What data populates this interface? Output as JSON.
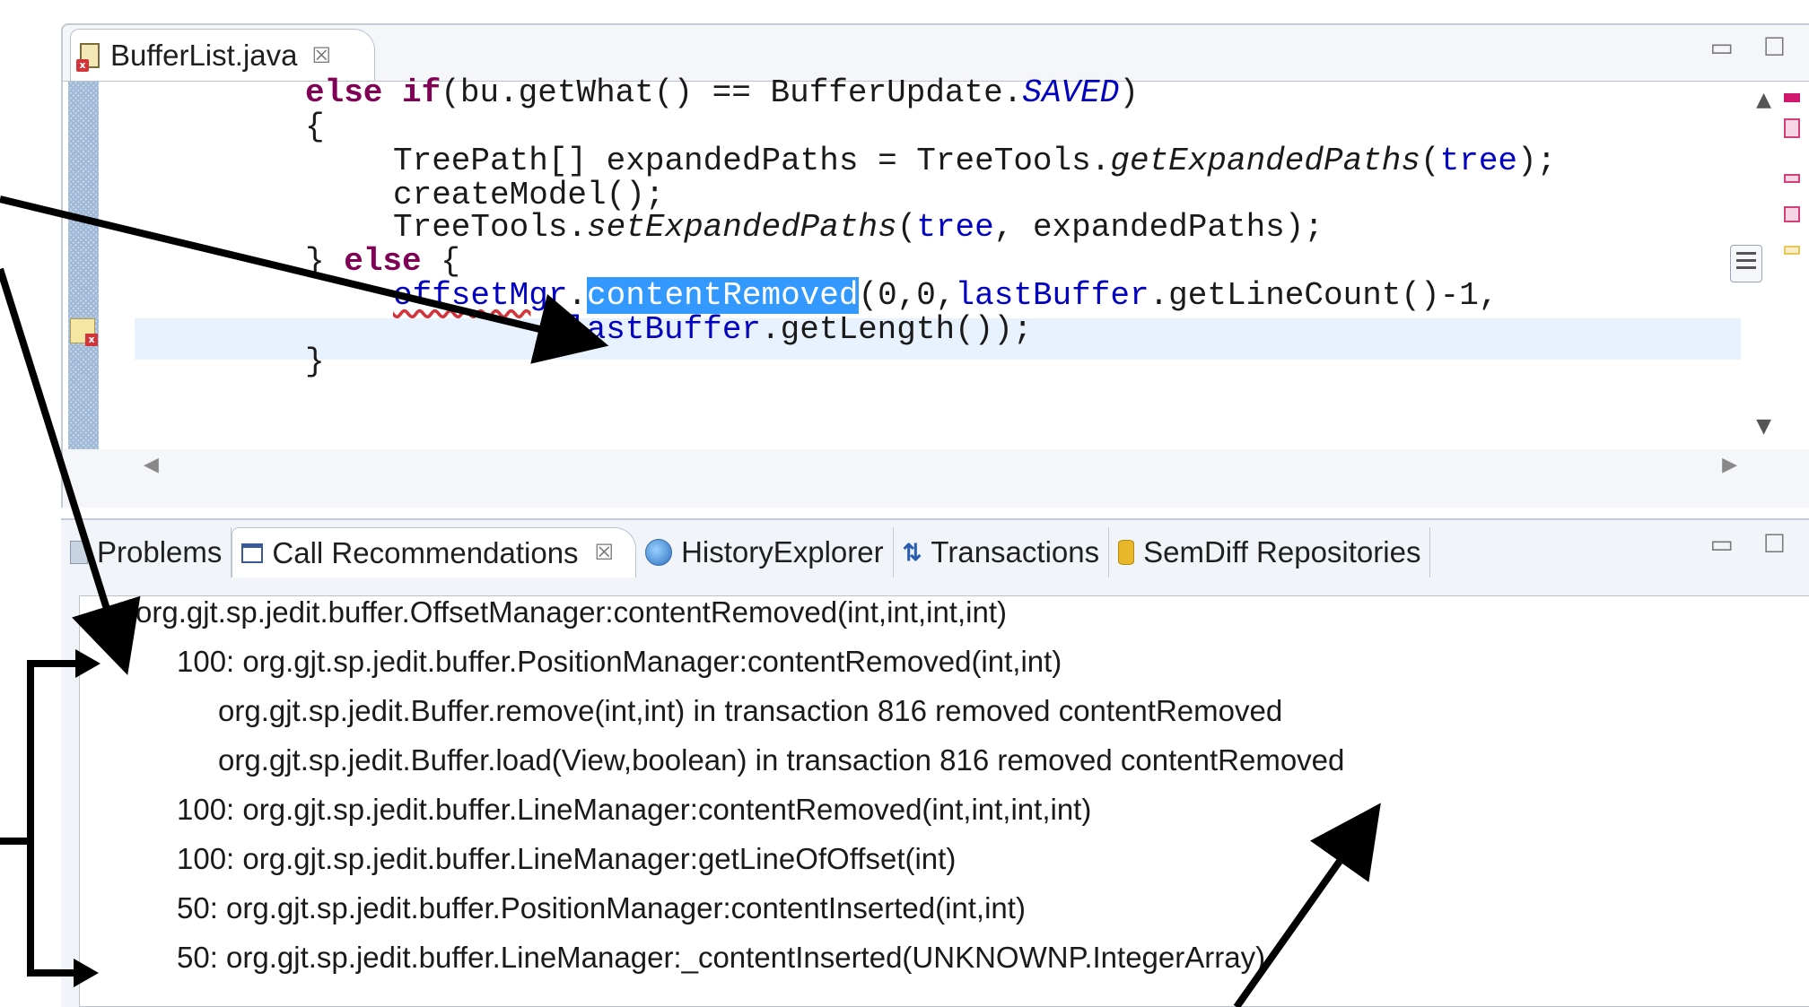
{
  "editor": {
    "tab_label": "BufferList.java",
    "tab_close": "☒",
    "pane_controls": "▭ ☐",
    "code_lines": {
      "l1": {
        "kw1": "else if",
        "rest1": "(bu.getWhat() == BufferUpdate.",
        "const": "SAVED",
        "rest2": ")"
      },
      "l2": "{",
      "l3": {
        "a": "TreePath[] expandedPaths = TreeTools.",
        "it": "getExpandedPaths",
        "b": "(",
        "fld": "tree",
        "c": ");"
      },
      "l4": "createModel();",
      "l5": {
        "a": "TreeTools.",
        "it": "setExpandedPaths",
        "b": "(",
        "fld": "tree",
        "c": ", expandedPaths);"
      },
      "l6": {
        "a": "} ",
        "kw": "else",
        "b": " {"
      },
      "l7": {
        "err": "offsetMgr",
        "dot": ".",
        "sel": "contentRemoved",
        "a": "(0,0,",
        "fld": "lastBuffer",
        "b": ".getLineCount()-1,"
      },
      "l8": {
        "fld": "lastBuffer",
        "a": ".getLength());"
      },
      "l9": "}"
    }
  },
  "views": {
    "tabs": [
      {
        "label": "Problems"
      },
      {
        "label": "Call Recommendations",
        "close": "☒"
      },
      {
        "label": "HistoryExplorer"
      },
      {
        "label": "Transactions"
      },
      {
        "label": "SemDiff Repositories"
      }
    ],
    "pane_controls": "▭ ☐"
  },
  "recommendations": [
    "org.gjt.sp.jedit.buffer.OffsetManager:contentRemoved(int,int,int,int)",
    "100: org.gjt.sp.jedit.buffer.PositionManager:contentRemoved(int,int)",
    "org.gjt.sp.jedit.Buffer.remove(int,int) in transaction 816 removed contentRemoved",
    "org.gjt.sp.jedit.Buffer.load(View,boolean) in transaction 816 removed contentRemoved",
    "100: org.gjt.sp.jedit.buffer.LineManager:contentRemoved(int,int,int,int)",
    "100: org.gjt.sp.jedit.buffer.LineManager:getLineOfOffset(int)",
    "50: org.gjt.sp.jedit.buffer.PositionManager:contentInserted(int,int)",
    "50: org.gjt.sp.jedit.buffer.LineManager:_contentInserted(UNKNOWNP.IntegerArray)"
  ]
}
